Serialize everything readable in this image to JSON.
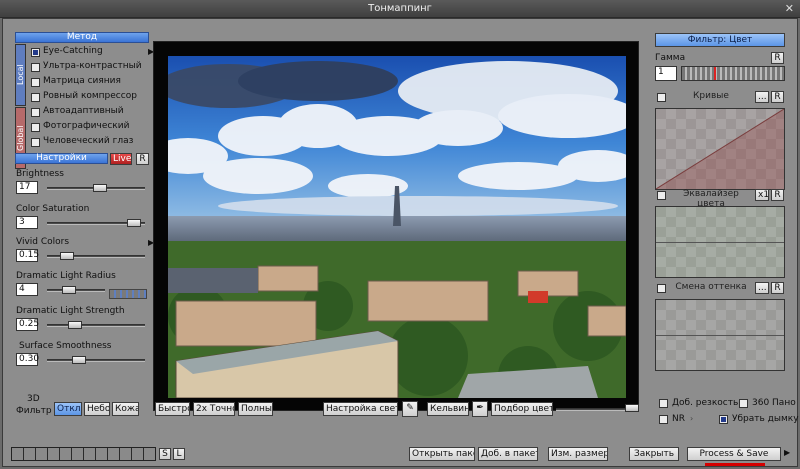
{
  "window": {
    "title": "Тонмаппинг",
    "close": "✕"
  },
  "method": {
    "header": "Метод",
    "tab_local": "Local",
    "tab_global": "Global",
    "items": [
      {
        "label": "Eye-Catching",
        "checked": true
      },
      {
        "label": "Ультра-контрастный",
        "checked": false
      },
      {
        "label": "Матрица сияния",
        "checked": false
      },
      {
        "label": "Ровный компрессор",
        "checked": false
      },
      {
        "label": "Автоадаптивный",
        "checked": false
      },
      {
        "label": "Фотографический",
        "checked": false
      },
      {
        "label": "Человеческий глаз",
        "checked": false
      }
    ]
  },
  "settings": {
    "header": "Настройки",
    "live": "Live",
    "reset": "R",
    "params": [
      {
        "label": "Brightness",
        "value": "17",
        "level": 0.55
      },
      {
        "label": "Color Saturation",
        "value": "3",
        "level": 0.95
      },
      {
        "label": "Vivid Colors",
        "value": "0.15",
        "level": 0.15
      },
      {
        "label": "Dramatic Light Radius",
        "value": "4",
        "level": 0.35
      },
      {
        "label": "Dramatic Light Strength",
        "value": "0.25",
        "level": 0.25
      },
      {
        "label": "Surface Smoothness",
        "value": "0.30",
        "level": 0.3
      }
    ]
  },
  "filter3d": {
    "label_top": "3D",
    "label_bottom": "Фильтр",
    "buttons": [
      "Откл.",
      "Небо",
      "Кожа"
    ]
  },
  "bottom_toolbar": {
    "quality": [
      "Быстро",
      "2х Точно",
      "Полный"
    ],
    "light_settings": "Настройка света",
    "kelvin": "Кельвин",
    "color_pick": "Подбор цвета"
  },
  "right_panel": {
    "filter_header": "Фильтр: Цвет",
    "gamma_label": "Гамма",
    "gamma_value": "1",
    "reset": "R",
    "curves": "Кривые",
    "curves_more": "...",
    "equalizer": "Эквалайзер цвета",
    "x1": "x1",
    "hue_shift": "Смена оттенка",
    "options": [
      {
        "label": "Доб. резкость",
        "checked": false
      },
      {
        "label": "360 Пано",
        "checked": false
      },
      {
        "label": "NR",
        "checked": false
      },
      {
        "label": "Убрать дымку",
        "checked": true
      }
    ]
  },
  "footer": {
    "s": "S",
    "l": "L",
    "open_batch": "Открыть пакет",
    "add_batch": "Доб. в пакет",
    "resize": "Изм. размер",
    "close": "Закрыть",
    "process_save": "Process & Save",
    "accent": "#d40000"
  },
  "colors": {
    "header_blue": "#3a74d6",
    "panel_bg": "#8d8d8d",
    "live_red": "#c4262a"
  }
}
